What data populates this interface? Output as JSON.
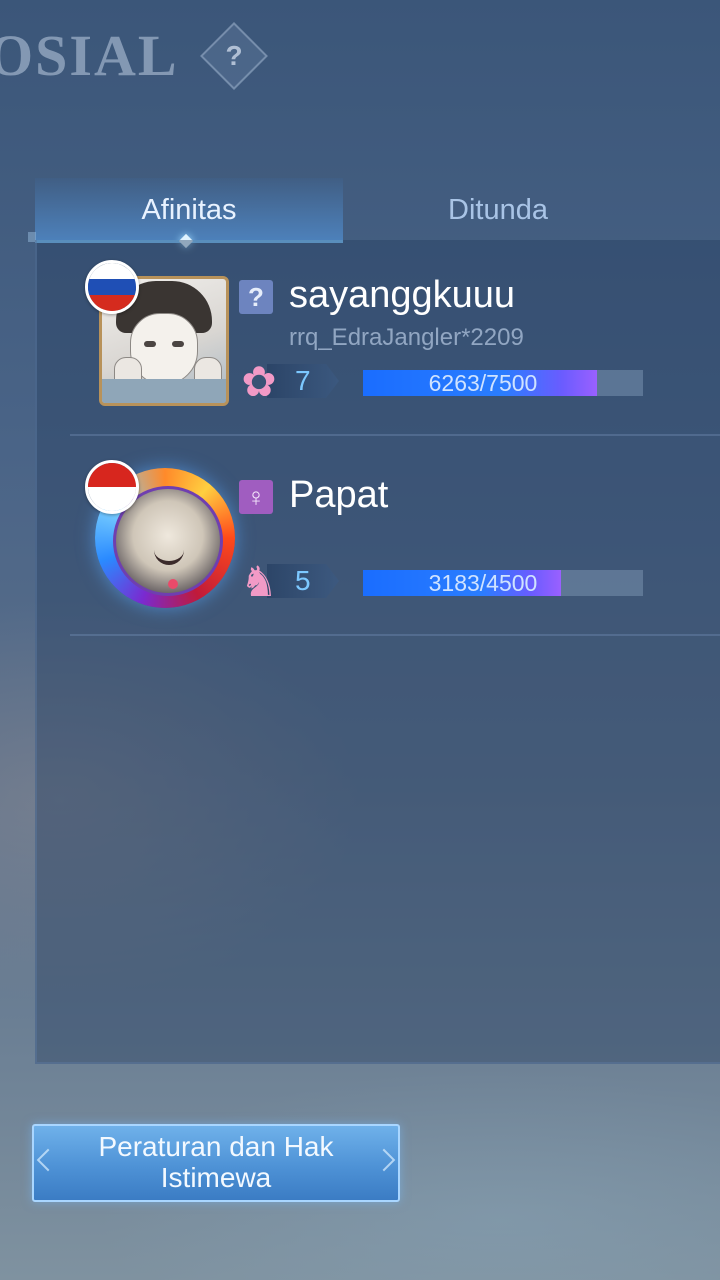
{
  "header": {
    "title": "OSIAL",
    "help_icon": "?"
  },
  "tabs": [
    {
      "label": "Afinitas",
      "active": true
    },
    {
      "label": "Ditunda",
      "active": false
    }
  ],
  "friends": [
    {
      "name": "sayanggkuuu",
      "subname": "rrq_EdraJangler*2209",
      "flag": "russia-flag",
      "gender_icon": "?",
      "gender": "unknown",
      "affinity_icon": "rose-icon",
      "affinity_glyph": "✿",
      "level": "7",
      "progress_text": "6263/7500",
      "progress_fraction": 0.835
    },
    {
      "name": "Papat",
      "subname": "",
      "flag": "indonesia-flag",
      "gender_icon": "♀",
      "gender": "female",
      "affinity_icon": "unicorn-icon",
      "affinity_glyph": "♞",
      "level": "5",
      "progress_text": "3183/4500",
      "progress_fraction": 0.707
    }
  ],
  "footer": {
    "rules_button_line1": "Peraturan dan Hak",
    "rules_button_line2": "Istimewa"
  },
  "colors": {
    "accent": "#4e92d6",
    "progress": "#1a6dff",
    "progress_tip": "#9a60ff",
    "level_text": "#7cc8ff"
  }
}
